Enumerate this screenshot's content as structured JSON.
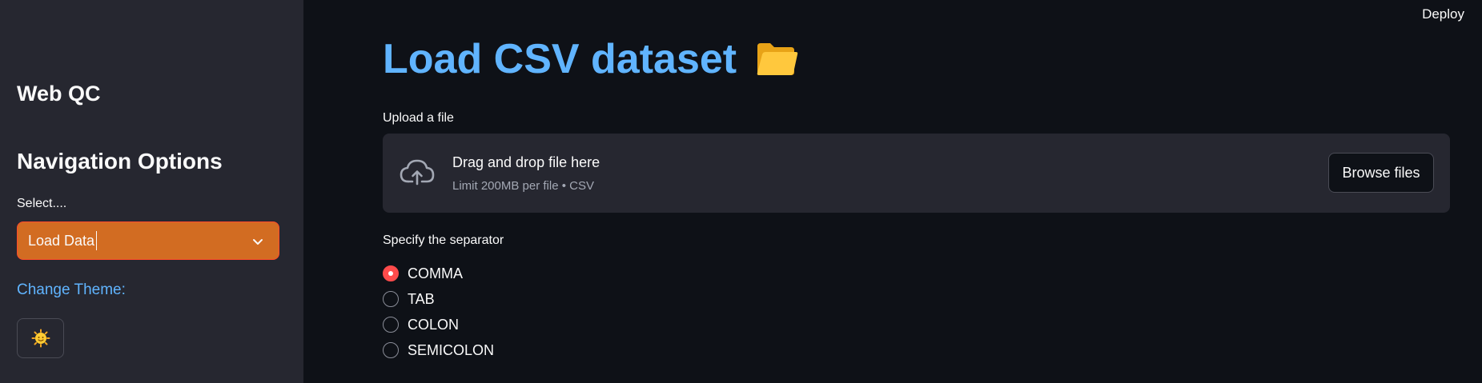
{
  "sidebar": {
    "app_title": "Web QC",
    "nav_heading": "Navigation Options",
    "select_label": "Select....",
    "select_value": "Load Data",
    "change_theme_label": "Change Theme:",
    "theme_button_icon": "sun-face-icon"
  },
  "header": {
    "deploy_label": "Deploy"
  },
  "main": {
    "title": "Load CSV dataset",
    "title_icon": "folder-icon",
    "upload": {
      "label": "Upload a file",
      "drop_text": "Drag and drop file here",
      "limit_text": "Limit 200MB per file • CSV",
      "browse_label": "Browse files"
    },
    "separator": {
      "label": "Specify the separator",
      "options": [
        "COMMA",
        "TAB",
        "COLON",
        "SEMICOLON"
      ],
      "selected": "COMMA"
    }
  },
  "colors": {
    "accent": "#ff4b4b",
    "title_blue": "#60b4ff",
    "select_bg": "#d26c22",
    "sidebar_bg": "#262730",
    "main_bg": "#0e1117"
  }
}
